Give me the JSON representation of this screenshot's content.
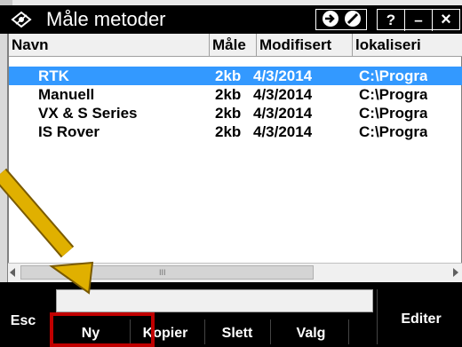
{
  "window": {
    "title": "Måle metoder"
  },
  "list": {
    "columns": [
      "Navn",
      "Måle",
      "Modifisert",
      "lokaliseri"
    ],
    "rows": [
      {
        "name": "RTK",
        "size": "2kb",
        "date": "4/3/2014",
        "path": "C:\\Progra",
        "selected": true
      },
      {
        "name": "Manuell",
        "size": "2kb",
        "date": "4/3/2014",
        "path": "C:\\Progra",
        "selected": false
      },
      {
        "name": "VX & S Series",
        "size": "2kb",
        "date": "4/3/2014",
        "path": "C:\\Progra",
        "selected": false
      },
      {
        "name": "IS Rover",
        "size": "2kb",
        "date": "4/3/2014",
        "path": "C:\\Progra",
        "selected": false
      }
    ]
  },
  "scrollbar": {
    "thumb_marker": "III"
  },
  "softkeys": {
    "esc": "Esc",
    "new": "Ny",
    "copy": "Kopier",
    "delete": "Slett",
    "options": "Valg",
    "edit": "Editer"
  },
  "titlebar_buttons": {
    "help": "?",
    "minimize": "–",
    "close": "×"
  },
  "colors": {
    "selection": "#3399ff",
    "highlight_box": "#c00000",
    "arrow": "#e0b000"
  }
}
